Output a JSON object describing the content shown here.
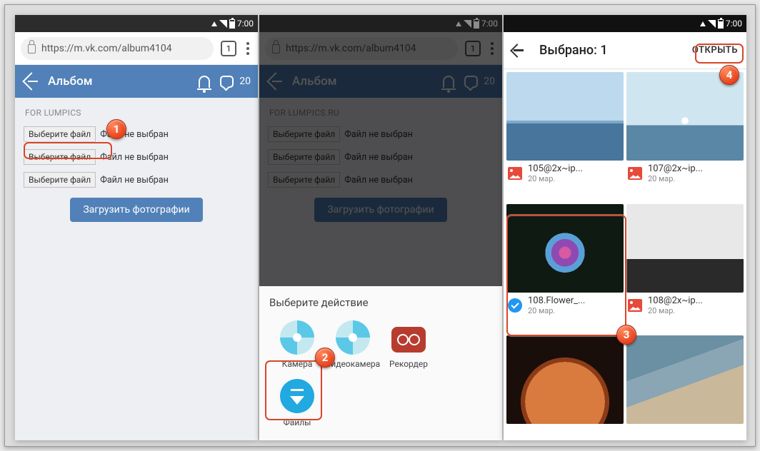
{
  "status": {
    "time": "7:00"
  },
  "url": {
    "text": "https://m.vk.com/album4104",
    "tabs": "1"
  },
  "vk": {
    "title": "Альбом",
    "msg_count": "20",
    "section_label": "FOR LUMPICS",
    "section_label_ru": "FOR LUMPICS.RU",
    "file_btn": "Выберите файл",
    "file_status": "Файл не выбран",
    "upload_btn": "Загрузить фотографии"
  },
  "sheet": {
    "title": "Выберите действие",
    "apps": {
      "camera": "Камера",
      "video": "Видеокамера",
      "recorder": "Рекордер",
      "files": "Файлы"
    }
  },
  "picker": {
    "title": "Выбрано: 1",
    "open": "ОТКРЫТЬ",
    "tiles": [
      {
        "name": "105@2x~ip...",
        "date": "20 мар."
      },
      {
        "name": "107@2x~ip...",
        "date": "20 мар."
      },
      {
        "name": "108.Flower_...",
        "date": "20 мар."
      },
      {
        "name": "108@2x~ip...",
        "date": "20 мар."
      }
    ]
  },
  "callouts": {
    "n1": "1",
    "n2": "2",
    "n3": "3",
    "n4": "4"
  }
}
